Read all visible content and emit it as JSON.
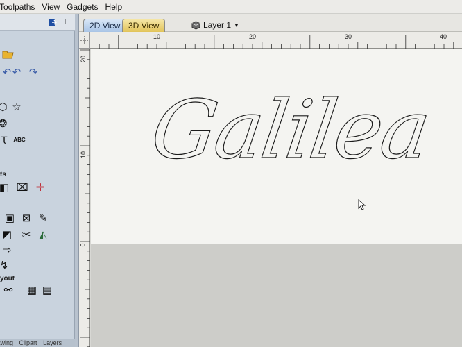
{
  "menu": [
    "Toolpaths",
    "View",
    "Gadgets",
    "Help"
  ],
  "toolbox": {
    "section_labels": [
      "ts",
      "yout"
    ],
    "bottom_tabs": [
      "Drawing",
      "Clipart",
      "Layers"
    ]
  },
  "tabs": {
    "view2d": "2D View",
    "view3d": "3D View"
  },
  "layer": {
    "name": "Layer 1"
  },
  "ruler": {
    "horizontal": [
      "10",
      "20",
      "30",
      "40"
    ],
    "vertical": [
      "20",
      "10",
      "0"
    ]
  },
  "canvas": {
    "text": "Galilea"
  },
  "icons": [
    "open-folder-icon",
    "undo-icon",
    "redo-icon",
    "star-icon",
    "text-icon",
    "node-edit-icon",
    "cursor-icon",
    "layer-icon"
  ]
}
